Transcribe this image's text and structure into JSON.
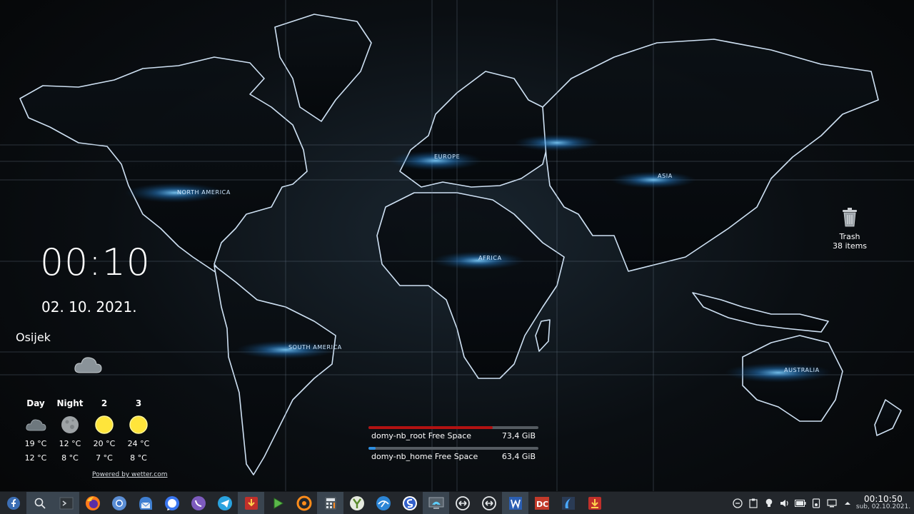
{
  "wallpaper": {
    "labels": [
      "NORTH AMERICA",
      "SOUTH AMERICA",
      "EUROPE",
      "AFRICA",
      "ASIA",
      "AUSTRALIA"
    ],
    "accent": "#3aa6ff"
  },
  "clock_widget": {
    "time": "00:10",
    "date": "02. 10. 2021."
  },
  "weather_widget": {
    "city": "Osijek",
    "current_icon": "cloud-icon",
    "forecast": [
      {
        "label": "Day",
        "icon": "cloud-icon",
        "high": "19 °C",
        "low": "12 °C"
      },
      {
        "label": "Night",
        "icon": "moon-icon",
        "high": "12 °C",
        "low": "8 °C"
      },
      {
        "label": "2",
        "icon": "sun-icon",
        "high": "20 °C",
        "low": "7 °C"
      },
      {
        "label": "3",
        "icon": "sun-icon",
        "high": "24 °C",
        "low": "8 °C"
      }
    ],
    "powered_by": "Powered by wetter.com"
  },
  "disks": [
    {
      "name": "domy-nb_root Free Space",
      "value": "73,4 GiB",
      "used_fraction": 0.73,
      "color": "#b31212"
    },
    {
      "name": "domy-nb_home Free Space",
      "value": "63,4 GiB",
      "used_fraction": 0.04,
      "color": "#2d8ee0"
    }
  ],
  "desktop": {
    "trash": {
      "label": "Trash",
      "count": "38 items"
    }
  },
  "panel": {
    "launchers": [
      "fedora-menu-icon",
      "search-icon",
      "terminal-icon",
      "firefox-icon",
      "chromium-icon",
      "mail-client-icon",
      "signal-icon",
      "viber-icon",
      "telegram-icon",
      "downloader-icon",
      "media-player-icon",
      "xsane-icon",
      "calculator-icon",
      "y-app-icon",
      "network-app-icon",
      "simplenote-icon",
      "remote-desktop-icon",
      "sync-icon-1",
      "sync-icon-2",
      "word-icon",
      "doublecmd-icon",
      "wireshark-icon",
      "download-manager-icon"
    ],
    "tray": [
      "notifications-icon",
      "clipboard-icon",
      "bulb-icon",
      "volume-icon",
      "battery-icon",
      "usb-device-icon",
      "display-icon",
      "tray-expand-icon"
    ],
    "clock_time": "00:10:50",
    "clock_date": "sub, 02.10.2021."
  }
}
